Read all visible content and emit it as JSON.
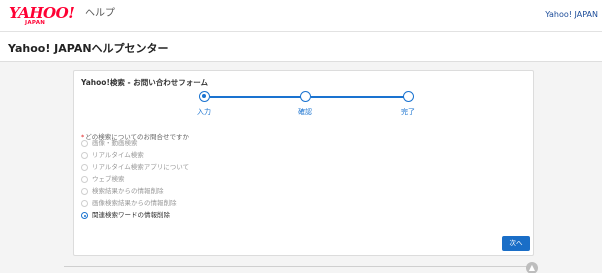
{
  "header": {
    "logo_text": "YAHOO!",
    "logo_sub": "JAPAN",
    "logo_help": "ヘルプ",
    "right_link": "Yahoo! JAPAN"
  },
  "page_title": "Yahoo! JAPANヘルプセンター",
  "form": {
    "title": "Yahoo!検索 - お問い合わせフォーム",
    "steps": [
      {
        "label": "入力",
        "active": true
      },
      {
        "label": "確認",
        "active": false
      },
      {
        "label": "完了",
        "active": false
      }
    ],
    "question_required_mark": "*",
    "question_label": "どの検索についてのお問合せですか",
    "options": [
      {
        "label": "画像・動画検索",
        "selected": false
      },
      {
        "label": "リアルタイム検索",
        "selected": false
      },
      {
        "label": "リアルタイム検索アプリについて",
        "selected": false
      },
      {
        "label": "ウェブ検索",
        "selected": false
      },
      {
        "label": "検索結果からの情報削除",
        "selected": false
      },
      {
        "label": "画像検索結果からの情報削除",
        "selected": false
      },
      {
        "label": "関連検索ワードの情報削除",
        "selected": true
      }
    ],
    "next_button": "次へ"
  },
  "scroll_top_icon": "arrow-up-icon",
  "colors": {
    "accent": "#1a73d0",
    "brand": "#ff0033",
    "button": "#1a6ec7"
  }
}
